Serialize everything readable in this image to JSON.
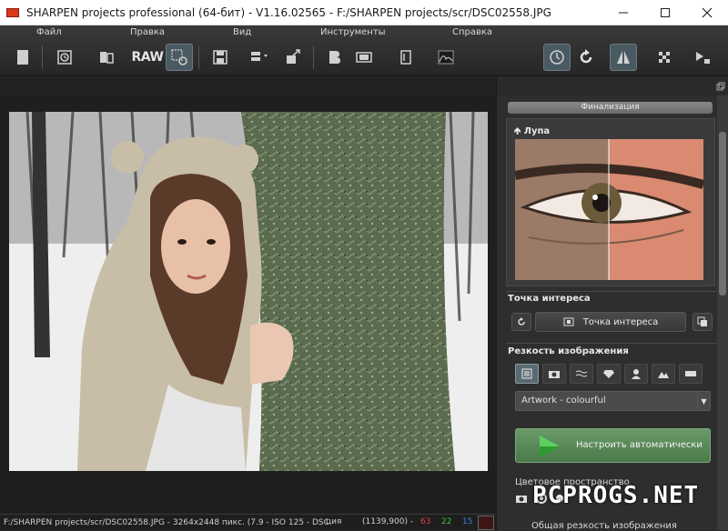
{
  "window": {
    "title": "SHARPEN projects professional (64-бит)  -  V1.16.02565  -  F:/SHARPEN projects/scr/DSC02558.JPG",
    "minimize_icon": "minimize-icon",
    "maximize_icon": "maximize-icon",
    "close_icon": "close-icon"
  },
  "menu": {
    "file": "Файл",
    "edit": "Правка",
    "view": "Вид",
    "tools": "Инструменты",
    "help": "Справка"
  },
  "toolbar": {
    "raw_label": "RAW"
  },
  "sidebar": {
    "panel_header": "Финализация",
    "loupe_title": "Лупа",
    "poi_title": "Точка интереса",
    "poi_button": "Точка интереса",
    "sharpness_title": "Резкость изображения",
    "preset_value": "Artwork - colourful",
    "auto_button": "Настроить автоматически",
    "color_space_label": "Цветовое пространство",
    "overall_label": "Общая резкость изображения"
  },
  "statusbar": {
    "path_info": "F:/SHARPEN projects/scr/DSC02558.JPG - 3264x2448 пикс. (7.9 - ISO 125 - DSC",
    "suffix": "ция",
    "coords": "(1139,900) -",
    "r": "63",
    "g": "22",
    "b": "15",
    "r_color": "#e04040",
    "g_color": "#40c040",
    "b_color": "#4080e0"
  },
  "watermark": "PCPROGS.NET"
}
